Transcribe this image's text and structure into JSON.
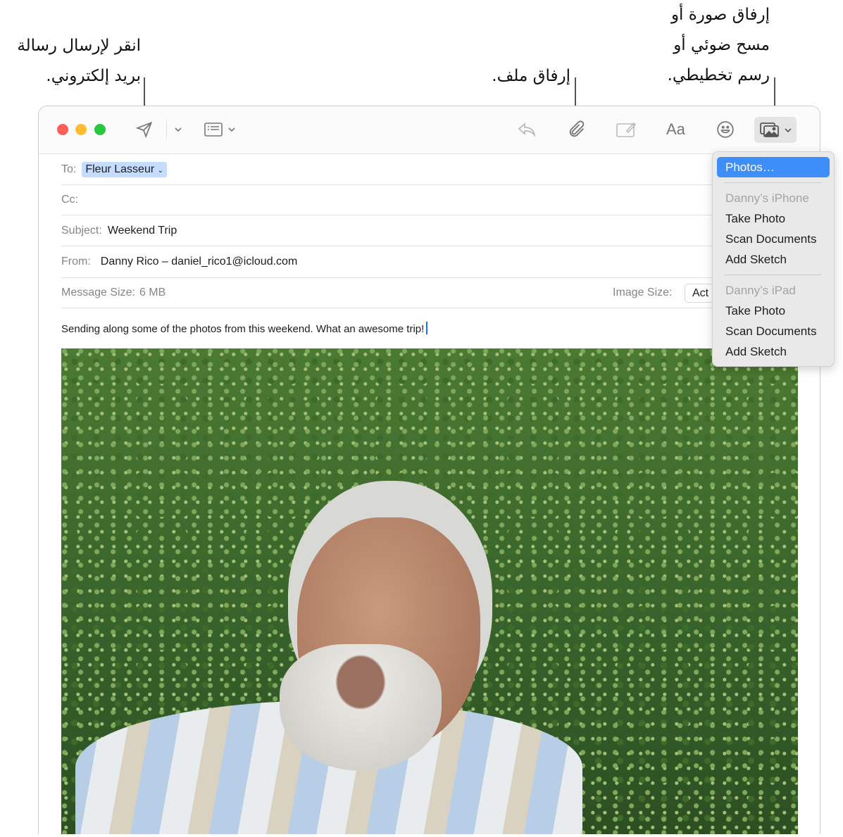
{
  "callouts": {
    "send": [
      "انقر لإرسال رسالة",
      "بريد إلكتروني."
    ],
    "attach": [
      "إرفاق ملف."
    ],
    "photo": [
      "إرفاق صورة أو",
      "مسح ضوئي أو",
      "رسم تخطيطي."
    ]
  },
  "toolbar": {
    "icons": [
      "send-icon",
      "chevron-down-icon",
      "header-fields-icon",
      "reply-icon",
      "paperclip-icon",
      "markup-icon",
      "format-text-icon",
      "emoji-icon",
      "photo-browser-icon"
    ],
    "format_label": "Aa"
  },
  "fields": {
    "to_label": "To:",
    "to_value": "Fleur Lasseur",
    "cc_label": "Cc:",
    "subject_label": "Subject:",
    "subject_value": "Weekend Trip",
    "from_label": "From:",
    "from_value": "Danny Rico – daniel_rico1@icloud.com",
    "size_label": "Message Size:",
    "size_value": "6 MB",
    "image_size_label": "Image Size:",
    "image_size_value": "Act"
  },
  "body": {
    "text": "Sending along some of the photos from this weekend. What an awesome trip!"
  },
  "menu": {
    "photos": "Photos…",
    "iphone_header": "Danny’s iPhone",
    "iphone_items": [
      "Take Photo",
      "Scan Documents",
      "Add Sketch"
    ],
    "ipad_header": "Danny’s iPad",
    "ipad_items": [
      "Take Photo",
      "Scan Documents",
      "Add Sketch"
    ],
    "accent": "#3d8ef8"
  }
}
